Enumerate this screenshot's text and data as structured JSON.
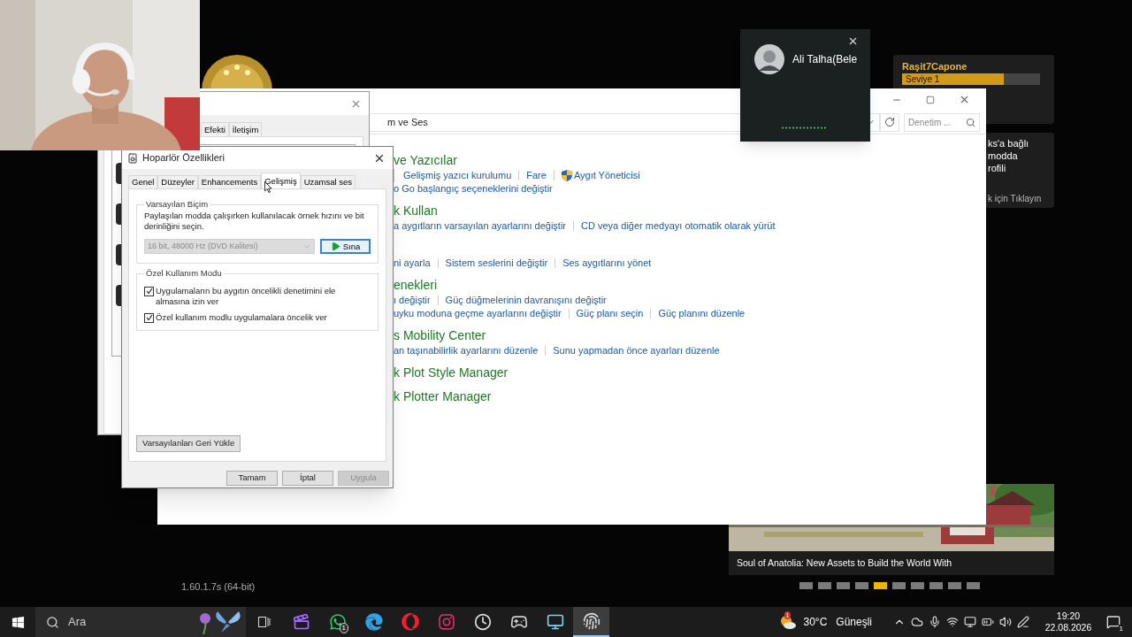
{
  "launcher": {
    "profile": {
      "name": "Raşit7Capone",
      "level_label": "Seviye 1",
      "level": 0.74
    },
    "notice_lines": [
      "ks'a bağlı",
      "modda",
      "rofili"
    ],
    "notice_link": "k için Tıklayın",
    "news": {
      "caption": "Soul of Anatolia: New Assets to Build the World With",
      "pages": [
        {
          "selected": false
        },
        {
          "selected": false
        },
        {
          "selected": false
        },
        {
          "selected": false
        },
        {
          "selected": true
        },
        {
          "selected": false
        },
        {
          "selected": false
        },
        {
          "selected": false
        },
        {
          "selected": false
        },
        {
          "selected": false
        }
      ]
    },
    "version": "1.60.1.7s (64-bit)"
  },
  "control_panel": {
    "address": "m ve Ses",
    "search_placeholder": "Denetim ...",
    "sections": [
      {
        "heading": "ve Yazıcılar",
        "rows": [
          {
            "continued": true,
            "links": [
              {
                "kind": "plain",
                "text": "Gelişmiş yazıcı kurulumu"
              },
              {
                "kind": "plain",
                "text": "Fare"
              },
              {
                "kind": "admin",
                "text": "Aygıt Yöneticisi"
              }
            ]
          },
          {
            "continued": false,
            "links": [
              {
                "kind": "plain",
                "text": "o Go başlangıç seçeneklerini değiştir"
              }
            ]
          }
        ]
      },
      {
        "heading": "k Kullan",
        "rows": [
          {
            "continued": false,
            "links": [
              {
                "kind": "plain",
                "text": "a aygıtların varsayılan ayarlarını değiştir"
              },
              {
                "kind": "plain",
                "text": "CD veya diğer medyayı otomatik olarak yürüt"
              }
            ]
          }
        ]
      },
      {
        "rows": [
          {
            "continued": false,
            "links": [
              {
                "kind": "plain",
                "text": "ni ayarla"
              },
              {
                "kind": "plain",
                "text": "Sistem seslerini değiştir"
              },
              {
                "kind": "plain",
                "text": "Ses aygıtlarını yönet"
              }
            ]
          }
        ]
      },
      {
        "heading": "enekleri",
        "rows": [
          {
            "continued": false,
            "links": [
              {
                "kind": "plain",
                "text": "ı değiştir"
              },
              {
                "kind": "plain",
                "text": "Güç düğmelerinin davranışını değiştir"
              }
            ]
          },
          {
            "continued": false,
            "links": [
              {
                "kind": "plain",
                "text": "uyku moduna geçme ayarlarını değiştir"
              },
              {
                "kind": "plain",
                "text": "Güç planı seçin"
              },
              {
                "kind": "plain",
                "text": "Güç planını düzenle"
              }
            ]
          }
        ]
      },
      {
        "heading": "s Mobility Center",
        "rows": [
          {
            "continued": false,
            "links": [
              {
                "kind": "plain",
                "text": "an taşınabilirlik ayarlarını düzenle"
              },
              {
                "kind": "plain",
                "text": "Sunu yapmadan önce ayarları düzenle"
              }
            ]
          }
        ]
      },
      {
        "heading": "k Plot Style Manager"
      },
      {
        "heading": "k Plotter Manager"
      }
    ]
  },
  "sound_dialog": {
    "tabs": [
      {
        "label": "Efekti",
        "selected": false
      },
      {
        "label": "İletişim",
        "selected": false
      }
    ]
  },
  "speaker_dialog": {
    "title": "Hoparlör Özellikleri",
    "tabs": [
      {
        "label": "Genel",
        "selected": false
      },
      {
        "label": "Düzeyler",
        "selected": false
      },
      {
        "label": "Enhancements",
        "selected": false
      },
      {
        "label": "Gelişmiş",
        "selected": true
      },
      {
        "label": "Uzamsal ses",
        "selected": false
      }
    ],
    "default_format": {
      "legend": "Varsayılan Biçim",
      "description": "Paylaşılan modda çalışırken kullanılacak örnek hızını ve bit derinliğini seçin.",
      "format": "16 bit, 48000 Hz (DVD Kalitesi)",
      "format_disabled": true,
      "test_button": "Sına"
    },
    "exclusive": {
      "legend": "Özel Kullanım Modu",
      "options": [
        {
          "label": "Uygulamaların bu aygıtın öncelikli denetimini ele almasına izin ver",
          "checked": true
        },
        {
          "label": "Özel kullanım modlu uygulamalara öncelik ver",
          "checked": true
        }
      ]
    },
    "restore_button": "Varsayılanları Geri Yükle",
    "buttons": [
      {
        "label": "Tamam",
        "disabled": false
      },
      {
        "label": "İptal",
        "disabled": false
      },
      {
        "label": "Uygula",
        "disabled": true
      }
    ]
  },
  "call": {
    "name": "Ali Talha(Bele"
  },
  "taskbar": {
    "search_placeholder": "Ara",
    "apps": [
      {
        "kind": "clapper",
        "selected": false
      },
      {
        "kind": "whatsapp",
        "badge": "1",
        "selected": false
      },
      {
        "kind": "edge",
        "selected": false
      },
      {
        "kind": "opera",
        "selected": false
      },
      {
        "kind": "instagram",
        "selected": false
      },
      {
        "kind": "clock",
        "selected": false
      },
      {
        "kind": "game",
        "selected": false
      },
      {
        "kind": "monitor",
        "selected": false
      },
      {
        "kind": "finger",
        "selected": true
      }
    ],
    "weather": {
      "badge": "1",
      "temperature": "30°C",
      "condition": "Güneşli"
    },
    "time": "19:20",
    "date": "22.08.2026",
    "notifications": "1"
  }
}
